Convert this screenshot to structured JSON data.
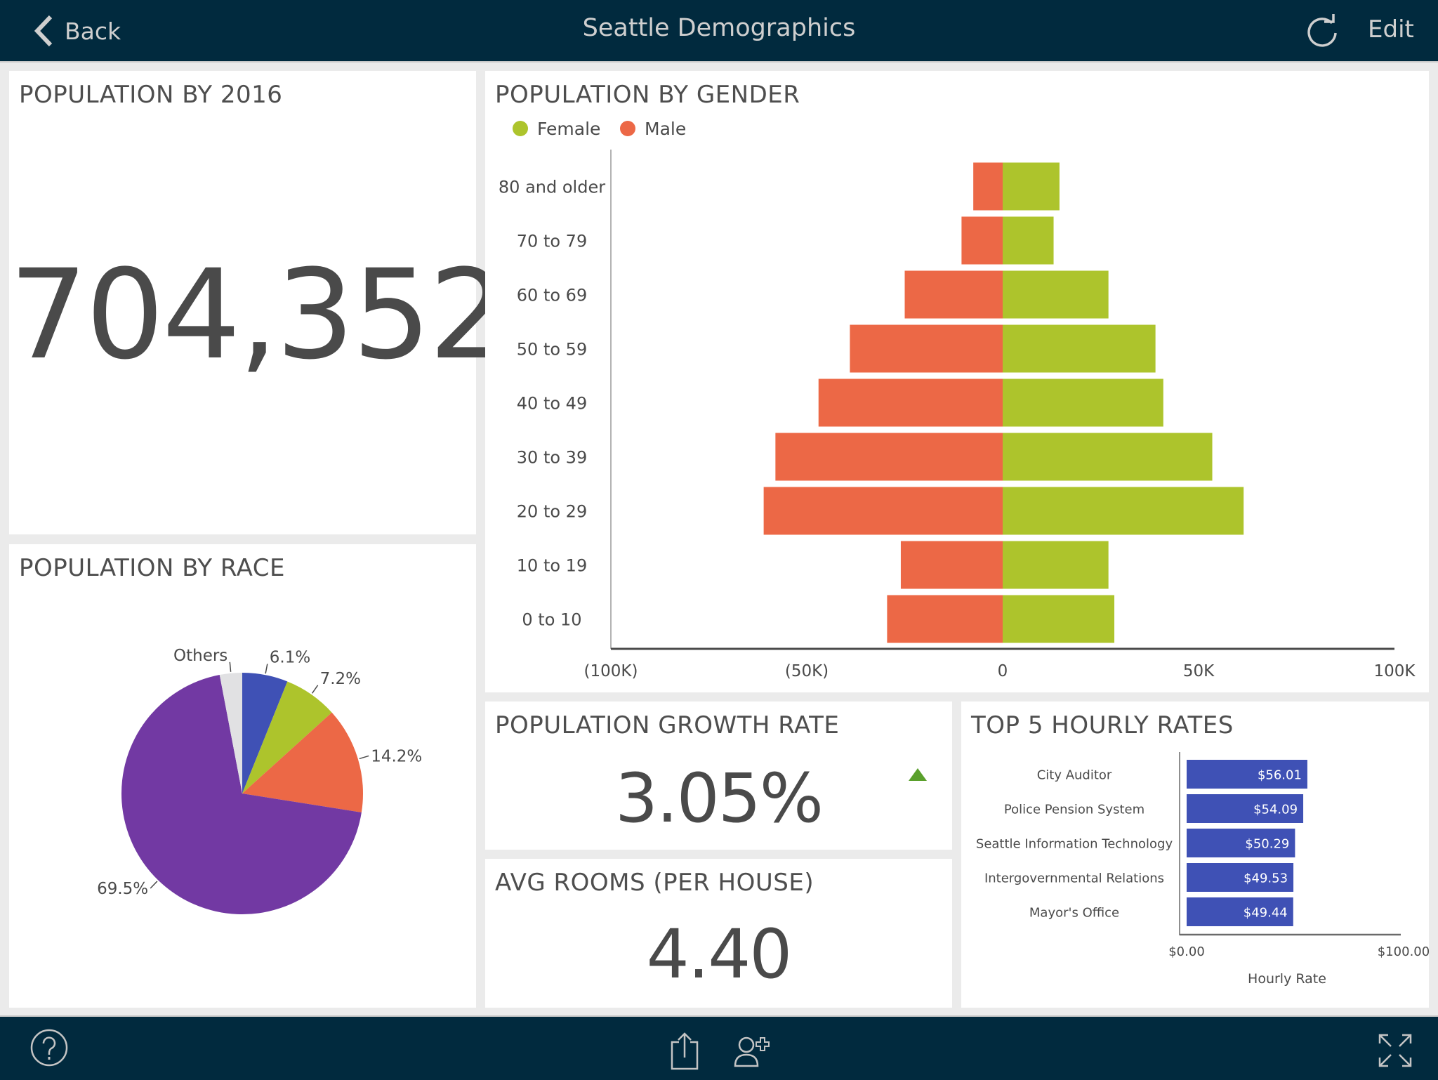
{
  "header": {
    "back_label": "Back",
    "title": "Seattle Demographics",
    "edit_label": "Edit",
    "icons": {
      "back": "chevron-left-icon",
      "refresh": "refresh-icon"
    }
  },
  "cards": {
    "population": {
      "title": "POPULATION BY 2016",
      "value": "704,352"
    },
    "race": {
      "title": "POPULATION BY RACE"
    },
    "gender": {
      "title": "POPULATION BY GENDER"
    },
    "growth": {
      "title": "POPULATION GROWTH RATE",
      "value": "3.05%",
      "trend": "up",
      "trend_color": "#5aa02c"
    },
    "rooms": {
      "title": "AVG ROOMS (PER HOUSE)",
      "value": "4.40"
    },
    "hourly": {
      "title": "TOP 5 HOURLY RATES"
    }
  },
  "footer": {
    "icons": [
      "help-icon",
      "share-icon",
      "add-user-icon",
      "fullscreen-icon"
    ]
  },
  "colors": {
    "header_bg": "#012a3e",
    "female": "#adc42c",
    "male": "#ec6846",
    "bar_blue": "#3f51b5",
    "pie_purple": "#7239a3",
    "pie_others": "#e1e1e3"
  },
  "chart_data": [
    {
      "type": "pie",
      "title": "POPULATION BY RACE",
      "slices": [
        {
          "label": "",
          "value": 6.1,
          "display": "6.1%",
          "color": "#3f51b5"
        },
        {
          "label": "",
          "value": 7.2,
          "display": "7.2%",
          "color": "#adc42c"
        },
        {
          "label": "",
          "value": 14.2,
          "display": "14.2%",
          "color": "#ec6846"
        },
        {
          "label": "",
          "value": 69.5,
          "display": "69.5%",
          "color": "#7239a3"
        },
        {
          "label": "Others",
          "value": 3.0,
          "display": "Others",
          "color": "#e1e1e3"
        }
      ]
    },
    {
      "type": "bar",
      "orientation": "horizontal-diverging",
      "title": "POPULATION BY GENDER",
      "categories": [
        "80 and older",
        "70 to 79",
        "60 to 69",
        "50 to 59",
        "40 to 49",
        "30 to 39",
        "20 to 29",
        "10 to 19",
        "0 to 10"
      ],
      "series": [
        {
          "name": "Female",
          "color": "#adc42c",
          "values": [
            14500,
            13000,
            27000,
            39000,
            41000,
            53500,
            61500,
            27000,
            28500
          ]
        },
        {
          "name": "Male",
          "color": "#ec6846",
          "values": [
            -7500,
            -10500,
            -25000,
            -39000,
            -47000,
            -58000,
            -61000,
            -26000,
            -29500
          ]
        }
      ],
      "xlim": [
        -100000,
        100000
      ],
      "xticks": [
        -100000,
        -50000,
        0,
        50000,
        100000
      ],
      "xtick_labels": [
        "(100K)",
        "(50K)",
        "0",
        "50K",
        "100K"
      ],
      "legend": "top-left",
      "grid": false
    },
    {
      "type": "bar",
      "orientation": "horizontal",
      "title": "TOP 5 HOURLY RATES",
      "categories": [
        "City Auditor",
        "Police Pension System",
        "Seattle Information Technology",
        "Intergovernmental Relations",
        "Mayor's Office"
      ],
      "values": [
        56.01,
        54.09,
        50.29,
        49.53,
        49.44
      ],
      "value_labels": [
        "$56.01",
        "$54.09",
        "$50.29",
        "$49.53",
        "$49.44"
      ],
      "xlim": [
        0,
        100
      ],
      "xtick_labels": [
        "$0.00",
        "$100.00"
      ],
      "xlabel": "Hourly Rate",
      "color": "#3f51b5"
    }
  ]
}
